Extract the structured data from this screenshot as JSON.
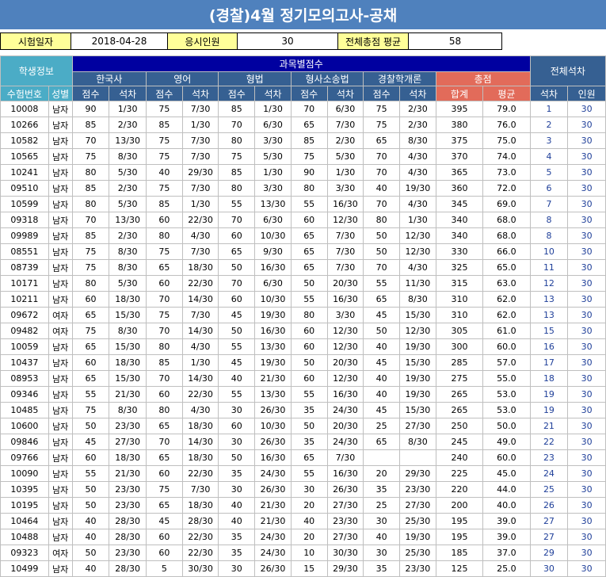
{
  "title": "(경찰)4월 정기모의고사-공채",
  "info": {
    "date_label": "시험일자",
    "date_value": "2018-04-28",
    "count_label": "응시인원",
    "count_value": "30",
    "avg_label": "전체총점 평균",
    "avg_value": "58"
  },
  "header": {
    "student_info": "학생정보",
    "subject_scores": "과목별점수",
    "overall_rank": "전체석차",
    "subjects": [
      "한국사",
      "영어",
      "형법",
      "형사소송법",
      "경찰학개론"
    ],
    "total": "총점",
    "exam_no": "수험번호",
    "gender": "성별",
    "score": "점수",
    "rank": "석차",
    "sum": "합계",
    "avg": "평균",
    "overall_rank_col": "석차",
    "people": "인원"
  },
  "rows": [
    [
      "10008",
      "남자",
      "90",
      "1/30",
      "75",
      "7/30",
      "85",
      "1/30",
      "70",
      "6/30",
      "75",
      "2/30",
      "395",
      "79.0",
      "1",
      "30"
    ],
    [
      "10266",
      "남자",
      "85",
      "2/30",
      "85",
      "1/30",
      "70",
      "6/30",
      "65",
      "7/30",
      "75",
      "2/30",
      "380",
      "76.0",
      "2",
      "30"
    ],
    [
      "10582",
      "남자",
      "70",
      "13/30",
      "75",
      "7/30",
      "80",
      "3/30",
      "85",
      "2/30",
      "65",
      "8/30",
      "375",
      "75.0",
      "3",
      "30"
    ],
    [
      "10565",
      "남자",
      "75",
      "8/30",
      "75",
      "7/30",
      "75",
      "5/30",
      "75",
      "5/30",
      "70",
      "4/30",
      "370",
      "74.0",
      "4",
      "30"
    ],
    [
      "10241",
      "남자",
      "80",
      "5/30",
      "40",
      "29/30",
      "85",
      "1/30",
      "90",
      "1/30",
      "70",
      "4/30",
      "365",
      "73.0",
      "5",
      "30"
    ],
    [
      "09510",
      "남자",
      "85",
      "2/30",
      "75",
      "7/30",
      "80",
      "3/30",
      "80",
      "3/30",
      "40",
      "19/30",
      "360",
      "72.0",
      "6",
      "30"
    ],
    [
      "10599",
      "남자",
      "80",
      "5/30",
      "85",
      "1/30",
      "55",
      "13/30",
      "55",
      "16/30",
      "70",
      "4/30",
      "345",
      "69.0",
      "7",
      "30"
    ],
    [
      "09318",
      "남자",
      "70",
      "13/30",
      "60",
      "22/30",
      "70",
      "6/30",
      "60",
      "12/30",
      "80",
      "1/30",
      "340",
      "68.0",
      "8",
      "30"
    ],
    [
      "09989",
      "남자",
      "85",
      "2/30",
      "80",
      "4/30",
      "60",
      "10/30",
      "65",
      "7/30",
      "50",
      "12/30",
      "340",
      "68.0",
      "8",
      "30"
    ],
    [
      "08551",
      "남자",
      "75",
      "8/30",
      "75",
      "7/30",
      "65",
      "9/30",
      "65",
      "7/30",
      "50",
      "12/30",
      "330",
      "66.0",
      "10",
      "30"
    ],
    [
      "08739",
      "남자",
      "75",
      "8/30",
      "65",
      "18/30",
      "50",
      "16/30",
      "65",
      "7/30",
      "70",
      "4/30",
      "325",
      "65.0",
      "11",
      "30"
    ],
    [
      "10171",
      "남자",
      "80",
      "5/30",
      "60",
      "22/30",
      "70",
      "6/30",
      "50",
      "20/30",
      "55",
      "11/30",
      "315",
      "63.0",
      "12",
      "30"
    ],
    [
      "10211",
      "남자",
      "60",
      "18/30",
      "70",
      "14/30",
      "60",
      "10/30",
      "55",
      "16/30",
      "65",
      "8/30",
      "310",
      "62.0",
      "13",
      "30"
    ],
    [
      "09672",
      "여자",
      "65",
      "15/30",
      "75",
      "7/30",
      "45",
      "19/30",
      "80",
      "3/30",
      "45",
      "15/30",
      "310",
      "62.0",
      "13",
      "30"
    ],
    [
      "09482",
      "여자",
      "75",
      "8/30",
      "70",
      "14/30",
      "50",
      "16/30",
      "60",
      "12/30",
      "50",
      "12/30",
      "305",
      "61.0",
      "15",
      "30"
    ],
    [
      "10059",
      "남자",
      "65",
      "15/30",
      "80",
      "4/30",
      "55",
      "13/30",
      "60",
      "12/30",
      "40",
      "19/30",
      "300",
      "60.0",
      "16",
      "30"
    ],
    [
      "10437",
      "남자",
      "60",
      "18/30",
      "85",
      "1/30",
      "45",
      "19/30",
      "50",
      "20/30",
      "45",
      "15/30",
      "285",
      "57.0",
      "17",
      "30"
    ],
    [
      "08953",
      "남자",
      "65",
      "15/30",
      "70",
      "14/30",
      "40",
      "21/30",
      "60",
      "12/30",
      "40",
      "19/30",
      "275",
      "55.0",
      "18",
      "30"
    ],
    [
      "09346",
      "남자",
      "55",
      "21/30",
      "60",
      "22/30",
      "55",
      "13/30",
      "55",
      "16/30",
      "40",
      "19/30",
      "265",
      "53.0",
      "19",
      "30"
    ],
    [
      "10485",
      "남자",
      "75",
      "8/30",
      "80",
      "4/30",
      "30",
      "26/30",
      "35",
      "24/30",
      "45",
      "15/30",
      "265",
      "53.0",
      "19",
      "30"
    ],
    [
      "10600",
      "남자",
      "50",
      "23/30",
      "65",
      "18/30",
      "60",
      "10/30",
      "50",
      "20/30",
      "25",
      "27/30",
      "250",
      "50.0",
      "21",
      "30"
    ],
    [
      "09846",
      "남자",
      "45",
      "27/30",
      "70",
      "14/30",
      "30",
      "26/30",
      "35",
      "24/30",
      "65",
      "8/30",
      "245",
      "49.0",
      "22",
      "30"
    ],
    [
      "09766",
      "남자",
      "60",
      "18/30",
      "65",
      "18/30",
      "50",
      "16/30",
      "65",
      "7/30",
      "",
      "",
      "240",
      "60.0",
      "23",
      "30"
    ],
    [
      "10090",
      "남자",
      "55",
      "21/30",
      "60",
      "22/30",
      "35",
      "24/30",
      "55",
      "16/30",
      "20",
      "29/30",
      "225",
      "45.0",
      "24",
      "30"
    ],
    [
      "10395",
      "남자",
      "50",
      "23/30",
      "75",
      "7/30",
      "30",
      "26/30",
      "30",
      "26/30",
      "35",
      "23/30",
      "220",
      "44.0",
      "25",
      "30"
    ],
    [
      "10195",
      "남자",
      "50",
      "23/30",
      "65",
      "18/30",
      "40",
      "21/30",
      "20",
      "27/30",
      "25",
      "27/30",
      "200",
      "40.0",
      "26",
      "30"
    ],
    [
      "10464",
      "남자",
      "40",
      "28/30",
      "45",
      "28/30",
      "40",
      "21/30",
      "40",
      "23/30",
      "30",
      "25/30",
      "195",
      "39.0",
      "27",
      "30"
    ],
    [
      "10488",
      "남자",
      "40",
      "28/30",
      "60",
      "22/30",
      "35",
      "24/30",
      "20",
      "27/30",
      "40",
      "19/30",
      "195",
      "39.0",
      "27",
      "30"
    ],
    [
      "09323",
      "여자",
      "50",
      "23/30",
      "60",
      "22/30",
      "35",
      "24/30",
      "10",
      "30/30",
      "30",
      "25/30",
      "185",
      "37.0",
      "29",
      "30"
    ],
    [
      "10499",
      "남자",
      "40",
      "28/30",
      "5",
      "30/30",
      "30",
      "26/30",
      "15",
      "29/30",
      "35",
      "23/30",
      "125",
      "25.0",
      "30",
      "30"
    ]
  ]
}
